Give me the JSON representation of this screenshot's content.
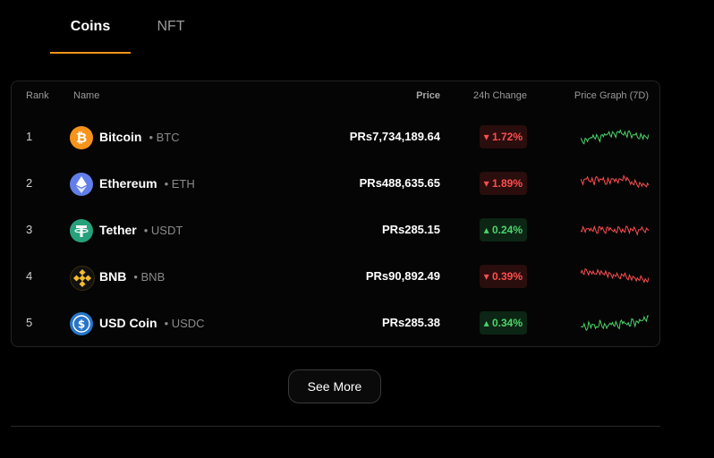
{
  "tabs": [
    {
      "label": "Coins",
      "active": true
    },
    {
      "label": "NFT",
      "active": false
    }
  ],
  "table": {
    "headers": {
      "rank": "Rank",
      "name": "Name",
      "price": "Price",
      "change": "24h Change",
      "graph": "Price Graph (7D)"
    },
    "rows": [
      {
        "rank": "1",
        "name": "Bitcoin",
        "symbol": "• BTC",
        "price": "PRs7,734,189.64",
        "change": "▾ 1.72%",
        "direction": "down",
        "trend": "up",
        "icon": "bitcoin-icon",
        "icon_color": "#f7931a"
      },
      {
        "rank": "2",
        "name": "Ethereum",
        "symbol": "• ETH",
        "price": "PRs488,635.65",
        "change": "▾ 1.89%",
        "direction": "down",
        "trend": "down",
        "icon": "ethereum-icon",
        "icon_color": "#627eea"
      },
      {
        "rank": "3",
        "name": "Tether",
        "symbol": "• USDT",
        "price": "PRs285.15",
        "change": "▴ 0.24%",
        "direction": "up",
        "trend": "down",
        "icon": "tether-icon",
        "icon_color": "#26a17b"
      },
      {
        "rank": "4",
        "name": "BNB",
        "symbol": "• BNB",
        "price": "PRs90,892.49",
        "change": "▾ 0.39%",
        "direction": "down",
        "trend": "down",
        "icon": "bnb-icon",
        "icon_color": "#f3ba2f"
      },
      {
        "rank": "5",
        "name": "USD Coin",
        "symbol": "• USDC",
        "price": "PRs285.38",
        "change": "▴ 0.34%",
        "direction": "up",
        "trend": "up",
        "icon": "usdc-icon",
        "icon_color": "#2775ca"
      }
    ]
  },
  "see_more_label": "See More",
  "colors": {
    "accent": "#f7931a",
    "positive": "#4cd46a",
    "negative": "#ff4d4f"
  }
}
